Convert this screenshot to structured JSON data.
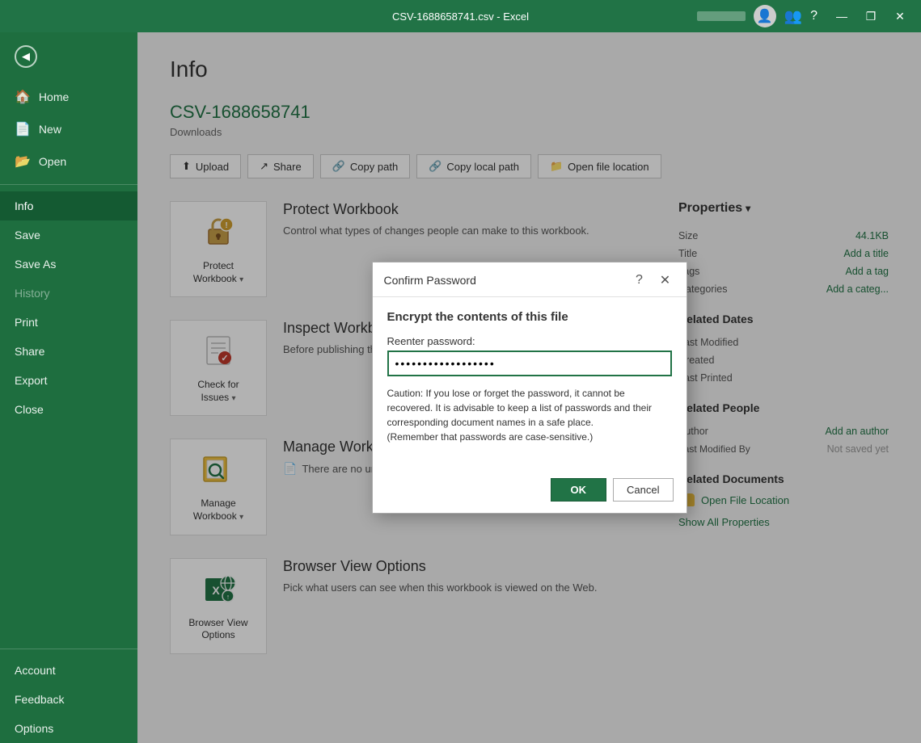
{
  "titlebar": {
    "title": "CSV-1688658741.csv  -  Excel",
    "minimize": "—",
    "restore": "❐",
    "close": "✕"
  },
  "sidebar": {
    "back_label": "",
    "items": [
      {
        "id": "home",
        "label": "Home",
        "icon": "🏠"
      },
      {
        "id": "new",
        "label": "New",
        "icon": "📄"
      },
      {
        "id": "open",
        "label": "Open",
        "icon": "📂"
      },
      {
        "id": "info",
        "label": "Info",
        "icon": "",
        "active": true
      },
      {
        "id": "save",
        "label": "Save",
        "icon": ""
      },
      {
        "id": "save-as",
        "label": "Save As",
        "icon": ""
      },
      {
        "id": "history",
        "label": "History",
        "icon": ""
      },
      {
        "id": "print",
        "label": "Print",
        "icon": ""
      },
      {
        "id": "share",
        "label": "Share",
        "icon": ""
      },
      {
        "id": "export",
        "label": "Export",
        "icon": ""
      },
      {
        "id": "close",
        "label": "Close",
        "icon": ""
      }
    ],
    "bottom_items": [
      {
        "id": "account",
        "label": "Account"
      },
      {
        "id": "feedback",
        "label": "Feedback"
      },
      {
        "id": "options",
        "label": "Options"
      }
    ]
  },
  "page": {
    "title": "Info",
    "file_name": "CSV-1688658741",
    "file_path": "Downloads"
  },
  "action_buttons": [
    {
      "id": "upload",
      "label": "Upload",
      "icon": "⬆"
    },
    {
      "id": "share",
      "label": "Share",
      "icon": "↗"
    },
    {
      "id": "copy-path",
      "label": "Copy path",
      "icon": "🔗"
    },
    {
      "id": "copy-local-path",
      "label": "Copy local path",
      "icon": "🔗"
    },
    {
      "id": "open-file-location",
      "label": "Open file location",
      "icon": "📁"
    }
  ],
  "sections": [
    {
      "id": "protect-workbook",
      "icon_label": "Protect\nWorkbook",
      "icon": "🔒",
      "title": "Protect Workbook",
      "description": "Control what types of changes people can make to this workbook.",
      "has_dropdown": true
    },
    {
      "id": "check-for-issues",
      "icon_label": "Check for\nIssues",
      "icon": "✔",
      "title": "Inspect Workbook",
      "description": "Before publishing this file, be aware that it contains:",
      "has_dropdown": true
    },
    {
      "id": "manage-workbook",
      "icon_label": "Manage\nWorkbook",
      "icon": "🔍",
      "title": "Manage Workbook",
      "description": "There are no unsaved changes.",
      "has_dropdown": false
    },
    {
      "id": "browser-view-options",
      "icon_label": "Browser View\nOptions",
      "icon": "🌐",
      "title": "Browser View Options",
      "description": "Pick what users can see when this workbook is viewed on the Web.",
      "has_dropdown": false
    }
  ],
  "properties": {
    "header": "Properties",
    "rows": [
      {
        "label": "Size",
        "value": "44.1KB",
        "value_class": "green"
      },
      {
        "label": "Title",
        "value": "Add a title",
        "value_class": "green"
      },
      {
        "label": "Tags",
        "value": "Add a tag",
        "value_class": "green"
      },
      {
        "label": "Categories",
        "value": "Add a categ...",
        "value_class": "green"
      }
    ],
    "related_dates": {
      "header": "Related Dates",
      "rows": [
        {
          "label": "Last Modified",
          "value": ""
        },
        {
          "label": "Created",
          "value": ""
        },
        {
          "label": "Last Printed",
          "value": ""
        }
      ]
    },
    "related_people": {
      "header": "Related People",
      "rows": [
        {
          "label": "Author",
          "value": "Add an author",
          "value_class": "green"
        },
        {
          "label": "Last Modified By",
          "value": "Not saved yet",
          "value_class": "muted"
        }
      ]
    },
    "related_documents": {
      "header": "Related Documents",
      "open_file_location": "Open File Location",
      "show_all": "Show All Properties"
    }
  },
  "modal": {
    "title": "Confirm Password",
    "heading": "Encrypt the contents of this file",
    "password_label": "Reenter password:",
    "password_value": "••••••••••••••••••",
    "warning": "Caution: If you lose or forget the password, it cannot be recovered. It is advisable to keep a list of passwords and their corresponding document names in a safe place.\n(Remember that passwords are case-sensitive.)",
    "ok_label": "OK",
    "cancel_label": "Cancel"
  }
}
